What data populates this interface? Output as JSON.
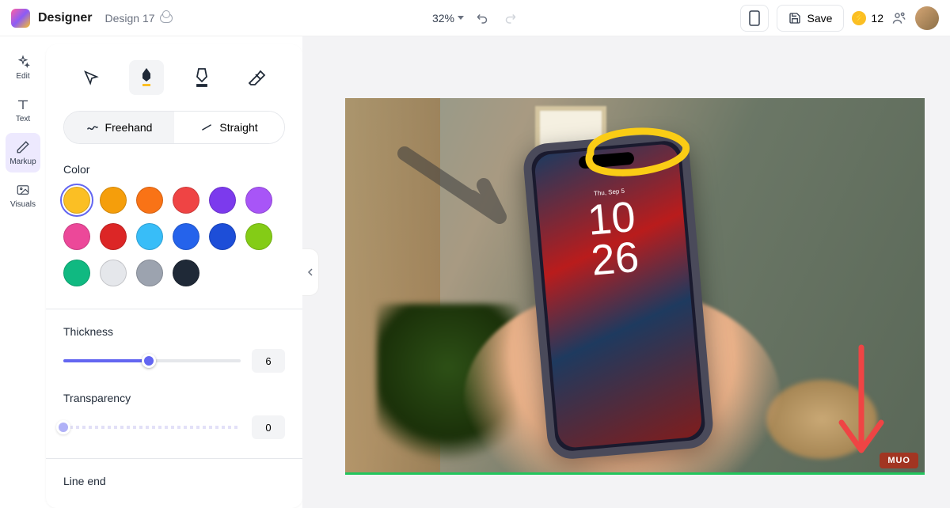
{
  "app": {
    "name": "Designer",
    "doc": "Design 17"
  },
  "zoom": {
    "value": "32%"
  },
  "save": {
    "label": "Save"
  },
  "credits": {
    "count": "12"
  },
  "sidebar": {
    "edit": "Edit",
    "text": "Text",
    "markup": "Markup",
    "visuals": "Visuals"
  },
  "panel": {
    "mode_freehand": "Freehand",
    "mode_straight": "Straight",
    "color_label": "Color",
    "thickness_label": "Thickness",
    "thickness_value": "6",
    "transparency_label": "Transparency",
    "transparency_value": "0",
    "line_end_label": "Line end",
    "colors": [
      "#fbbf24",
      "#f59e0b",
      "#f97316",
      "#ef4444",
      "#7c3aed",
      "#a855f7",
      "#ec4899",
      "#dc2626",
      "#38bdf8",
      "#2563eb",
      "#1d4ed8",
      "#84cc16",
      "#10b981",
      "#e5e7eb",
      "#9ca3af",
      "#1f2937"
    ],
    "selected_color_index": 0
  },
  "phone": {
    "time1": "10",
    "time2": "26",
    "date": "Thu, Sep 5"
  },
  "watermark": "MUO"
}
